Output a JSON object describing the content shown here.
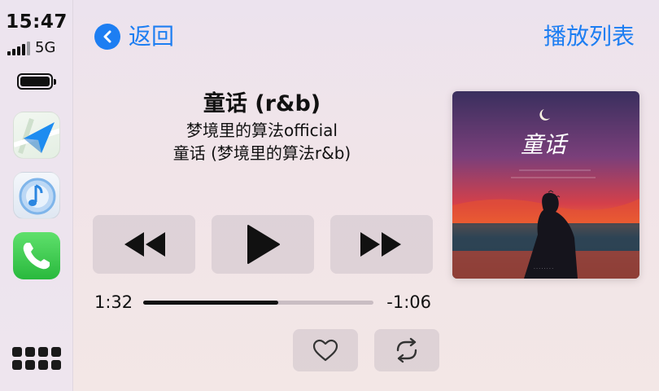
{
  "status": {
    "time": "15:47",
    "network": "5G"
  },
  "dock": {
    "apps": [
      {
        "name": "maps",
        "icon": "maps-navigation-icon"
      },
      {
        "name": "music",
        "icon": "music-note-icon"
      },
      {
        "name": "phone",
        "icon": "phone-handset-icon"
      }
    ],
    "grid_icon": "app-grid-icon"
  },
  "nav": {
    "back_label": "返回",
    "playlist_label": "播放列表"
  },
  "track": {
    "title": "童话 (r&b)",
    "artist": "梦境里的算法official",
    "album": "童话 (梦境里的算法r&b)"
  },
  "progress": {
    "elapsed": "1:32",
    "remaining": "-1:06",
    "fraction": 0.585
  },
  "artwork": {
    "title_text": "童话"
  },
  "colors": {
    "accent": "#1d7ef2",
    "background": "#efe4ec",
    "button_bg": "#d9cfd6"
  }
}
